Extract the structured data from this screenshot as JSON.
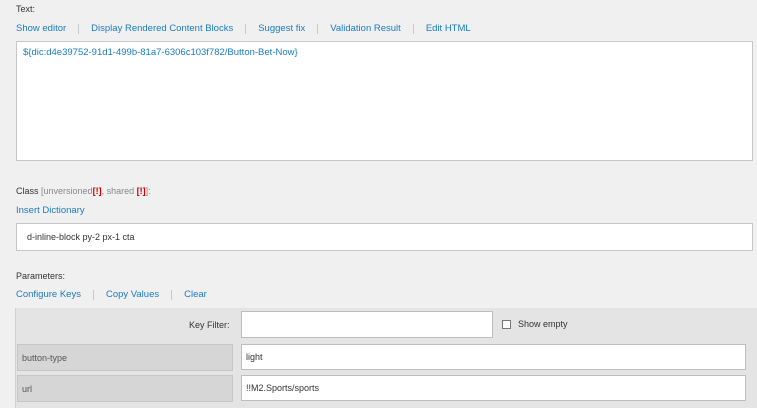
{
  "text_section": {
    "label": "Text:",
    "actions": [
      "Show editor",
      "Display Rendered Content Blocks",
      "Suggest fix",
      "Validation Result",
      "Edit HTML"
    ],
    "value": "${dic:d4e39752-91d1-499b-81a7-6306c103f782/Button-Bet-Now}"
  },
  "class_section": {
    "label": "Class",
    "unversioned": "[unversioned",
    "flag1": "[!]",
    "shared": ", shared",
    "flag2": "[!]",
    "suffix": "]:",
    "insert_link": "Insert Dictionary",
    "value": "d-inline-block py-2 px-1 cta"
  },
  "parameters": {
    "label": "Parameters:",
    "actions": [
      "Configure Keys",
      "Copy Values",
      "Clear"
    ],
    "key_filter_label": "Key Filter:",
    "key_filter_value": "",
    "show_empty_label": "Show empty",
    "rows": [
      {
        "key": "button-type",
        "value": "light"
      },
      {
        "key": "url",
        "value": "!!M2.Sports/sports"
      }
    ]
  }
}
